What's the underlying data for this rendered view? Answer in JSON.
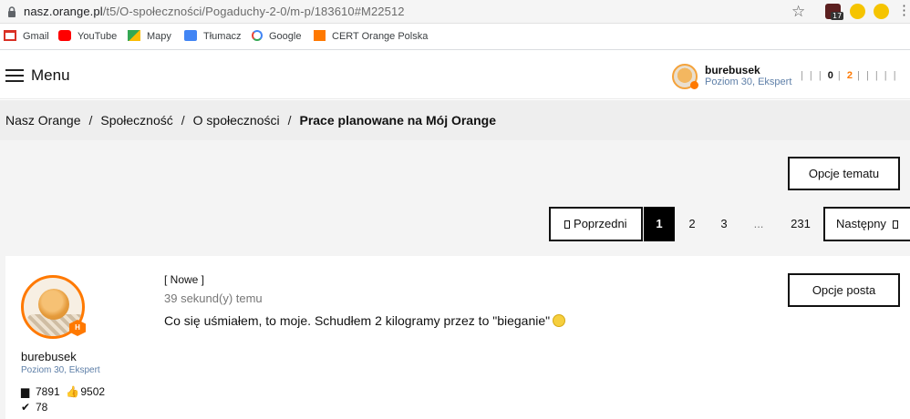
{
  "browser": {
    "url_host": "nasz.orange.pl",
    "url_path": "/t5/O-społeczności/Pogaduchy-2-0/m-p/183610#M22512",
    "ext_badge": "17"
  },
  "bookmarks": [
    {
      "label": "Gmail",
      "icon": "gmail-icon",
      "color": "#d93025"
    },
    {
      "label": "YouTube",
      "icon": "youtube-icon",
      "color": "#ff0000"
    },
    {
      "label": "Mapy",
      "icon": "maps-icon",
      "color": "#34a853"
    },
    {
      "label": "Tłumacz",
      "icon": "translate-icon",
      "color": "#4285f4"
    },
    {
      "label": "Google",
      "icon": "google-icon",
      "color": "#4285f4"
    },
    {
      "label": "CERT Orange Polska",
      "icon": "cert-icon",
      "color": "#ff7900"
    }
  ],
  "header": {
    "menu_label": "Menu",
    "username": "burebusek",
    "level": "Poziom 30, Ekspert",
    "counter_messages": "0",
    "counter_notifications": "2"
  },
  "breadcrumb": {
    "items": [
      "Nasz Orange",
      "Społeczność",
      "O społeczności"
    ],
    "separator": "/",
    "current": "Prace planowane na Mój Orange"
  },
  "toolbar": {
    "topic_options_label": "Opcje tematu"
  },
  "pager": {
    "prev_label": "Poprzedni",
    "pages": [
      "1",
      "2",
      "3",
      "...",
      "231"
    ],
    "active_page": "1",
    "next_label": "Następny"
  },
  "post": {
    "author": "burebusek",
    "level": "Poziom 30, Ekspert",
    "rank_badge": "H",
    "messages_count": "7891",
    "kudos_count": "9502",
    "solutions_count": "78",
    "new_tag": "[ Nowe ]",
    "time": "39 sekund(y) temu",
    "body": "Co się uśmiałem, to moje. Schudłem 2 kilogramy przez to \"bieganie\"",
    "options_label": "Opcje posta"
  },
  "colors": {
    "brand_orange": "#ff7900",
    "level_blue": "#5e7fa8"
  }
}
